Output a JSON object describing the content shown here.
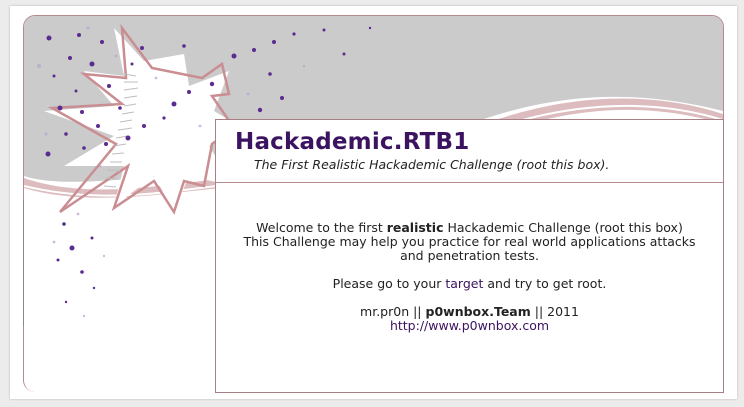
{
  "site": {
    "title": "Hackademic.RTB1",
    "tagline": "The First Realistic Hackademic Challenge (root this box)."
  },
  "welcome": {
    "prefix": "Welcome to the first ",
    "emphasis": "realistic",
    "suffix": " Hackademic Challenge (root this box)",
    "line2": "This Challenge may help you practice for real world applications attacks",
    "line3": "and penetration tests."
  },
  "instruction": {
    "prefix": "Please go to your ",
    "link": "target",
    "suffix": " and try to get root."
  },
  "credits": {
    "author": "mr.pr0n ||",
    "team": "p0wnbox.Team",
    "year": "|| 2011",
    "url": "http://www.p0wnbox.com"
  },
  "colors": {
    "title": "#3b1360",
    "link": "#3b1360",
    "header_bg": "#cccccc",
    "swoosh": "#d8b3b6",
    "star_outline": "#c98d92"
  }
}
